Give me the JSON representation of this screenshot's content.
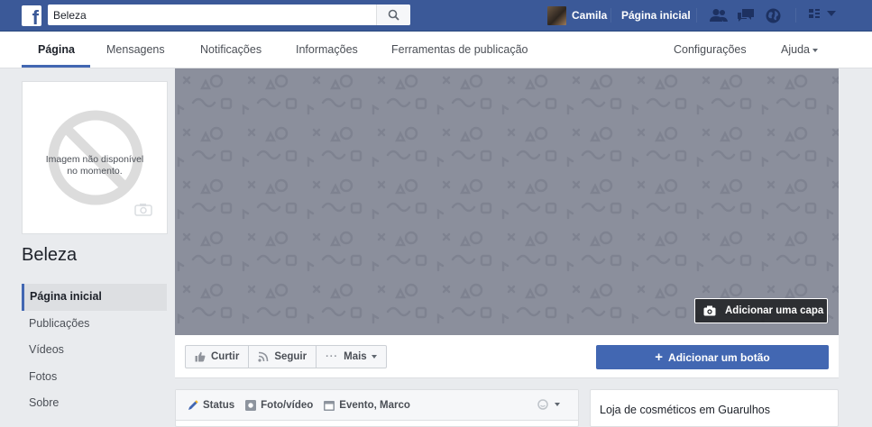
{
  "topbar": {
    "search_value": "Beleza",
    "profile_name": "Camila",
    "home_label": "Página inicial"
  },
  "subnav": {
    "tabs": [
      {
        "label": "Página"
      },
      {
        "label": "Mensagens"
      },
      {
        "label": "Notificações"
      },
      {
        "label": "Informações"
      },
      {
        "label": "Ferramentas de publicação"
      }
    ],
    "settings_label": "Configurações",
    "help_label": "Ajuda"
  },
  "left": {
    "no_image_line1": "Imagem não disponível",
    "no_image_line2": "no momento.",
    "page_title": "Beleza",
    "nav": [
      {
        "label": "Página inicial"
      },
      {
        "label": "Publicações"
      },
      {
        "label": "Vídeos"
      },
      {
        "label": "Fotos"
      },
      {
        "label": "Sobre"
      }
    ]
  },
  "cover": {
    "add_cover_label": "Adicionar uma capa"
  },
  "actions": {
    "like_label": "Curtir",
    "follow_label": "Seguir",
    "more_label": "Mais",
    "add_button_label": "Adicionar um botão"
  },
  "composer": {
    "status_label": "Status",
    "photo_label": "Foto/vídeo",
    "event_label": "Evento, Marco"
  },
  "about": {
    "description": "Loja de cosméticos em Guarulhos"
  },
  "colors": {
    "brand": "#3b5998",
    "accent": "#4267b2",
    "cover": "#8b8f9c"
  }
}
